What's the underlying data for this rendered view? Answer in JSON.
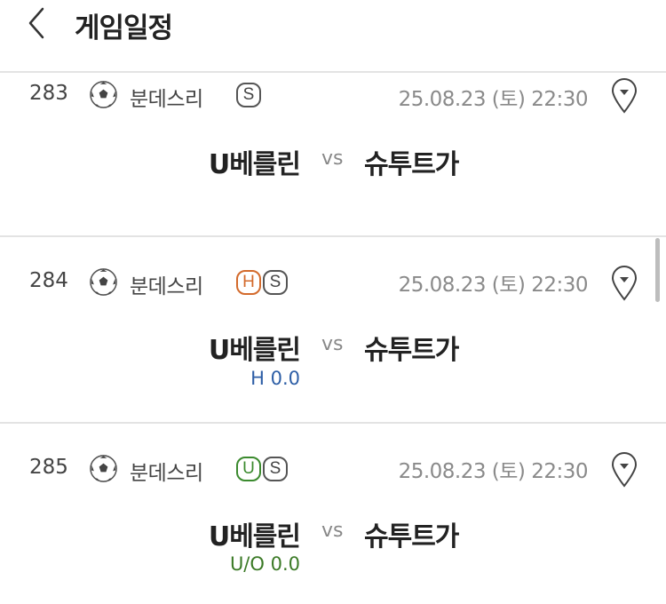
{
  "header": {
    "title": "게임일정",
    "back_icon": "chevron-left-icon"
  },
  "games": [
    {
      "no": "283",
      "sport_icon": "soccer-ball-icon",
      "league": "분데스리",
      "badges": [
        {
          "label": "S",
          "color": "#555555"
        }
      ],
      "datetime": "25.08.23 (토) 22:30",
      "home": "U베를린",
      "vs": "vs",
      "away": "슈투트가",
      "odds": ""
    },
    {
      "no": "284",
      "sport_icon": "soccer-ball-icon",
      "league": "분데스리",
      "badges": [
        {
          "label": "H",
          "color": "#d36a2b"
        },
        {
          "label": "S",
          "color": "#555555"
        }
      ],
      "datetime": "25.08.23 (토) 22:30",
      "home": "U베를린",
      "vs": "vs",
      "away": "슈투트가",
      "odds": "H 0.0"
    },
    {
      "no": "285",
      "sport_icon": "soccer-ball-icon",
      "league": "분데스리",
      "badges": [
        {
          "label": "U",
          "color": "#3b8a2e"
        },
        {
          "label": "S",
          "color": "#555555"
        }
      ],
      "datetime": "25.08.23 (토) 22:30",
      "home": "U베를린",
      "vs": "vs",
      "away": "슈투트가",
      "odds": "U/O 0.0"
    }
  ]
}
